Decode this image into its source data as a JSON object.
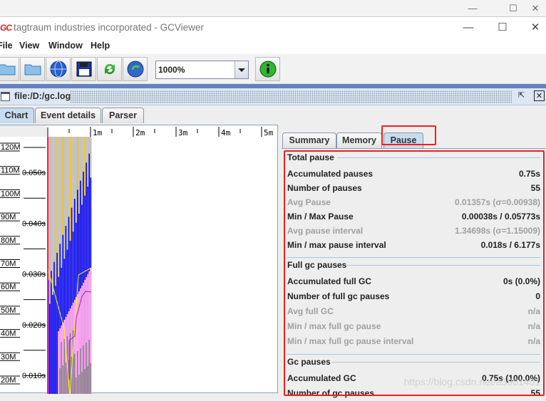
{
  "window": {
    "logo": "GC",
    "title": "tagtraum industries incorporated - GCViewer",
    "minimize": "—",
    "maximize": "☐",
    "close": "✕"
  },
  "menu": [
    {
      "label": "File",
      "key": "F"
    },
    {
      "label": "View",
      "key": "V"
    },
    {
      "label": "Window",
      "key": "W"
    },
    {
      "label": "Help",
      "key": "H"
    }
  ],
  "toolbar": {
    "zoom": "1000%",
    "buttons": [
      "open-file",
      "open-recent",
      "open-url",
      "export",
      "refresh",
      "watch",
      "about"
    ]
  },
  "frame": {
    "title": "file:/D:/gc.log"
  },
  "tabs": [
    "Chart",
    "Event details",
    "Parser"
  ],
  "selected_tab": "Chart",
  "chart": {
    "time_ticks": [
      "1m",
      "2m",
      "3m",
      "4m",
      "5m"
    ],
    "memory_ticks": [
      "120M",
      "110M",
      "100M",
      "90M",
      "80M",
      "70M",
      "60M",
      "50M",
      "40M",
      "30M",
      "20M"
    ],
    "pause_ticks": [
      "0.050s",
      "0.040s",
      "0.030s",
      "0.020s",
      "0.010s"
    ],
    "colors": {
      "total_heap": "#ffc000",
      "used_heap": "#0000ff",
      "tenured": "#ff66ff",
      "young": "#c0c0c0",
      "gc_times": "#00ff00",
      "full_gc": "#808080",
      "pause_line": "#ffff00"
    }
  },
  "stat_tabs": [
    "Summary",
    "Memory",
    "Pause"
  ],
  "selected_stat_tab": "Pause",
  "highlight_color": "#f01f1f",
  "groups": [
    {
      "title": "Total pause",
      "rows": [
        {
          "label": "Accumulated pauses",
          "value": "0.75s",
          "dim": false
        },
        {
          "label": "Number of pauses",
          "value": "55",
          "dim": false
        },
        {
          "label": "Avg Pause",
          "value": "0.01357s (σ=0.00938)",
          "dim": true
        },
        {
          "label": "Min / Max Pause",
          "value": "0.00038s / 0.05773s",
          "dim": false
        },
        {
          "label": "Avg pause interval",
          "value": "1.34698s (σ=1.15009)",
          "dim": true
        },
        {
          "label": "Min / max pause interval",
          "value": "0.018s / 6.177s",
          "dim": false
        }
      ]
    },
    {
      "title": "Full gc pauses",
      "rows": [
        {
          "label": "Accumulated full GC",
          "value": "0s (0.0%)",
          "dim": false
        },
        {
          "label": "Number of full gc pauses",
          "value": "0",
          "dim": false
        },
        {
          "label": "Avg full GC",
          "value": "n/a",
          "dim": true
        },
        {
          "label": "Min / max full gc pause",
          "value": "n/a",
          "dim": true
        },
        {
          "label": "Min / max full gc pause interval",
          "value": "n/a",
          "dim": true
        }
      ]
    },
    {
      "title": "Gc pauses",
      "rows": [
        {
          "label": "Accumulated GC",
          "value": "0.75s (100.0%)",
          "dim": false
        },
        {
          "label": "Number of gc pauses",
          "value": "55",
          "dim": false
        }
      ]
    }
  ],
  "watermark": "https://blog.csdn.net/a3961401"
}
